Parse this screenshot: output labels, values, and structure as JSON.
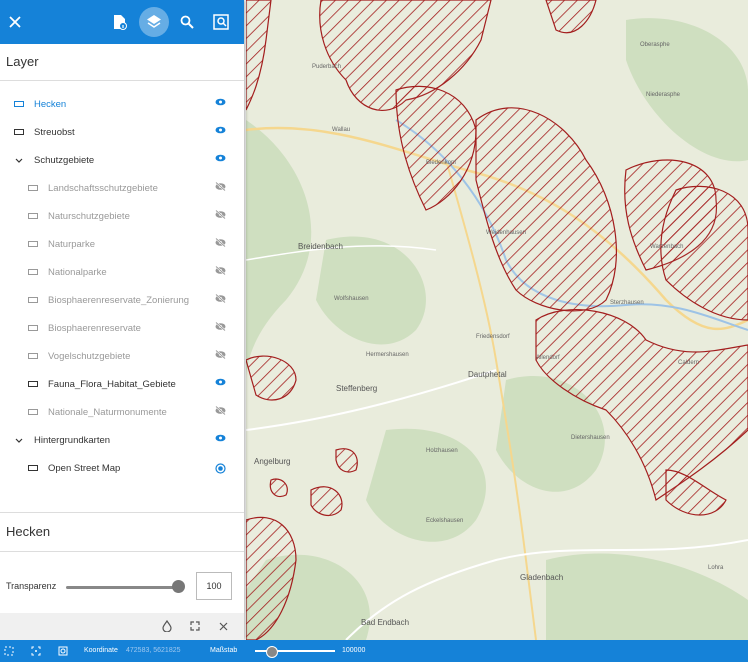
{
  "toolbar": {
    "close_icon": "close-icon",
    "buttons": [
      "file-info-icon",
      "layers-icon",
      "search-icon",
      "search-map-icon"
    ]
  },
  "layer_panel": {
    "title": "Layer",
    "items": [
      {
        "label": "Hecken",
        "state": "visible",
        "selected": true
      },
      {
        "label": "Streuobst",
        "state": "visible"
      },
      {
        "label": "Schutzgebiete",
        "state": "visible",
        "group": true
      },
      {
        "label": "Landschaftsschutzgebiete",
        "state": "hidden"
      },
      {
        "label": "Naturschutzgebiete",
        "state": "hidden"
      },
      {
        "label": "Naturparke",
        "state": "hidden"
      },
      {
        "label": "Nationalparke",
        "state": "hidden"
      },
      {
        "label": "Biosphaerenreservate_Zonierung",
        "state": "hidden"
      },
      {
        "label": "Biosphaerenreservate",
        "state": "hidden"
      },
      {
        "label": "Vogelschutzgebiete",
        "state": "hidden"
      },
      {
        "label": "Fauna_Flora_Habitat_Gebiete",
        "state": "visible"
      },
      {
        "label": "Nationale_Naturmonumente",
        "state": "hidden"
      },
      {
        "label": "Hintergrundkarten",
        "state": "visible",
        "group": true
      },
      {
        "label": "Open Street Map",
        "state": "radio-selected"
      }
    ]
  },
  "details": {
    "title": "Hecken",
    "transparency_label": "Transparenz",
    "transparency_value": "100"
  },
  "statusbar": {
    "coord_label": "Koordinate",
    "coord_value": "472583, 5621825",
    "scale_label": "Maßstab",
    "scale_value": "100000"
  },
  "map": {
    "place_labels": [
      "Oberasphe",
      "Niederasphe",
      "Puderbach",
      "Biedenkopf",
      "Wallau",
      "Breidenbach",
      "Wolfshausen",
      "Dautphetal",
      "Steffenberg",
      "Angelburg",
      "Bad Endbach",
      "Gladenbach",
      "Lohra",
      "Weidenhausen",
      "Dietershausen",
      "Eckelshausen",
      "Friedensdorf",
      "Allendorf",
      "Hermershausen",
      "Holzhausen",
      "Warzenbach",
      "Sterzhausen",
      "Caldern"
    ],
    "accent": "#1582d8",
    "hatch_color": "#a31e1e"
  }
}
